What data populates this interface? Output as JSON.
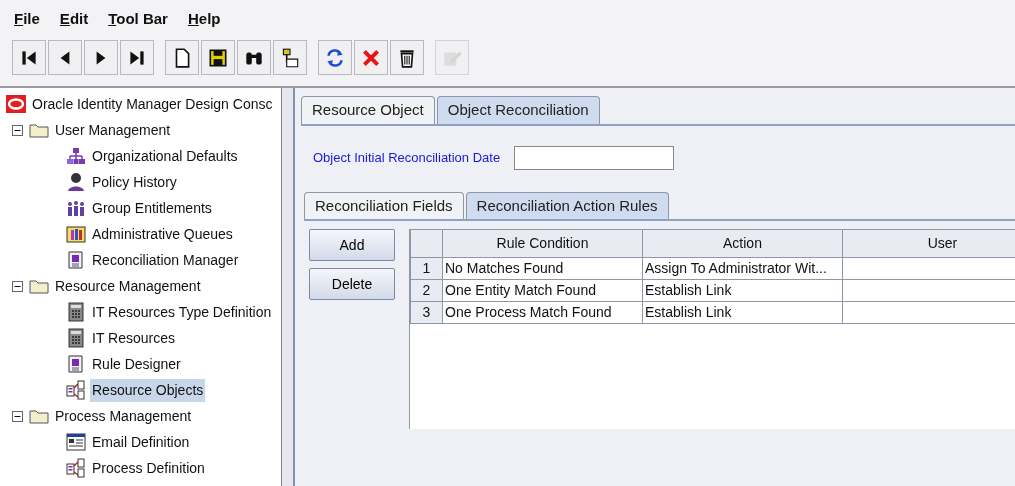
{
  "menu": [
    {
      "label": "File"
    },
    {
      "label": "Edit"
    },
    {
      "label": "Tool Bar"
    },
    {
      "label": "Help"
    }
  ],
  "toolbar": [
    [
      {
        "kind": "first",
        "disabled": false
      },
      {
        "kind": "previous",
        "disabled": false
      },
      {
        "kind": "next",
        "disabled": false
      },
      {
        "kind": "last",
        "disabled": false
      }
    ],
    [
      {
        "kind": "new",
        "disabled": false
      },
      {
        "kind": "save",
        "disabled": false
      },
      {
        "kind": "find",
        "disabled": false
      },
      {
        "kind": "pin",
        "disabled": false
      }
    ],
    [
      {
        "kind": "refresh",
        "disabled": false
      },
      {
        "kind": "close",
        "disabled": false
      },
      {
        "kind": "trash",
        "disabled": false
      }
    ],
    [
      {
        "kind": "edit",
        "disabled": true
      }
    ]
  ],
  "tree": {
    "label": "Oracle Identity Manager Design Consc",
    "kind": "logo",
    "children": [
      {
        "label": "User Management",
        "kind": "folder",
        "expanded": true,
        "children": [
          {
            "label": "Organizational Defaults",
            "kind": "org",
            "selected": false
          },
          {
            "label": "Policy History",
            "kind": "person",
            "selected": false
          },
          {
            "label": "Group Entitlements",
            "kind": "group",
            "selected": false
          },
          {
            "label": "Administrative Queues",
            "kind": "queue",
            "selected": false
          },
          {
            "label": "Reconciliation Manager",
            "kind": "doc",
            "selected": false
          }
        ]
      },
      {
        "label": "Resource Management",
        "kind": "folder",
        "expanded": true,
        "children": [
          {
            "label": "IT Resources Type Definition",
            "kind": "calc",
            "selected": false
          },
          {
            "label": "IT Resources",
            "kind": "calc",
            "selected": false
          },
          {
            "label": "Rule Designer",
            "kind": "doc",
            "selected": false
          },
          {
            "label": "Resource Objects",
            "kind": "diagram",
            "selected": true
          }
        ]
      },
      {
        "label": "Process Management",
        "kind": "folder",
        "expanded": true,
        "children": [
          {
            "label": "Email Definition",
            "kind": "form",
            "selected": false
          },
          {
            "label": "Process Definition",
            "kind": "diagram",
            "selected": false
          }
        ]
      }
    ]
  },
  "tabs": [
    {
      "label": "Resource Object",
      "selected": false
    },
    {
      "label": "Object Reconciliation",
      "selected": true
    }
  ],
  "date_field": {
    "label": "Object Initial Reconciliation Date"
  },
  "subtabs": [
    {
      "label": "Reconciliation Fields",
      "selected": false
    },
    {
      "label": "Reconciliation Action Rules",
      "selected": true
    }
  ],
  "buttons": [
    {
      "label": "Add"
    },
    {
      "label": "Delete"
    }
  ],
  "table": {
    "columns": [
      "Rule Condition",
      "Action",
      "User"
    ],
    "rows": [
      {
        "number": "1",
        "cells": [
          "No Matches Found",
          "Assign To Administrator Wit..."
        ]
      },
      {
        "number": "2",
        "cells": [
          "One Entity Match Found",
          "Establish Link"
        ]
      },
      {
        "number": "3",
        "cells": [
          "One Process Match Found",
          "Establish Link"
        ]
      }
    ]
  }
}
